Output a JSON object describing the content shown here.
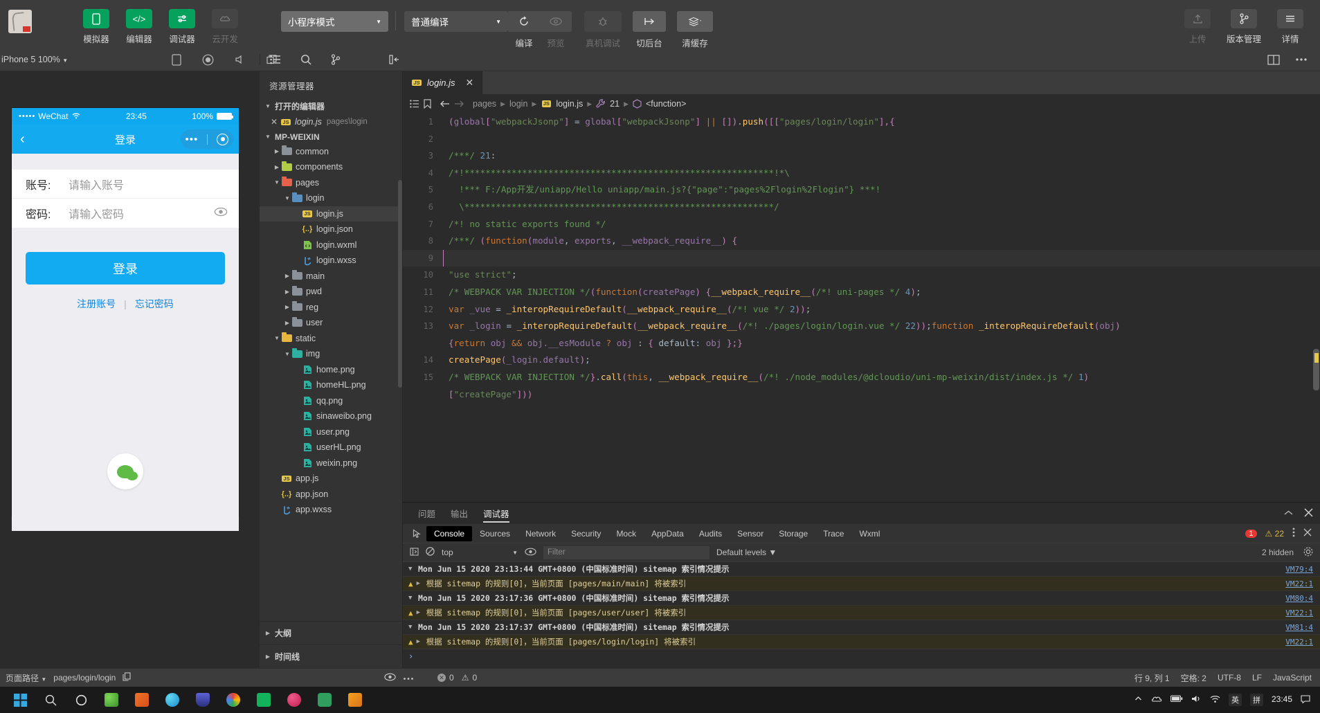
{
  "toolbar": {
    "items": [
      {
        "label": "模拟器",
        "icon": "phone-icon",
        "state": "active"
      },
      {
        "label": "编辑器",
        "icon": "code-icon",
        "state": "active"
      },
      {
        "label": "调试器",
        "icon": "sliders-icon",
        "state": "active"
      },
      {
        "label": "云开发",
        "icon": "cloud-icon",
        "state": "disabled"
      }
    ],
    "mode_select": "小程序模式",
    "compile_select": "普通编译",
    "compile_label": "编译",
    "preview_label": "预览",
    "remote_debug_label": "真机调试",
    "background_label": "切后台",
    "clear_cache_label": "清缓存",
    "upload_label": "上传",
    "version_label": "版本管理",
    "detail_label": "详情"
  },
  "subbar": {
    "device": "iPhone 5 100%"
  },
  "simulator": {
    "status": {
      "carrier": "WeChat",
      "dots": "•••••",
      "time": "23:45",
      "battery": "100%"
    },
    "nav_title": "登录",
    "form": [
      {
        "label": "账号:",
        "placeholder": "请输入账号",
        "value": "",
        "has_eye": false
      },
      {
        "label": "密码:",
        "placeholder": "请输入密码",
        "value": "",
        "has_eye": true
      }
    ],
    "login_button": "登录",
    "link_register": "注册账号",
    "link_divider": "|",
    "link_forgot": "忘记密码"
  },
  "explorer": {
    "title": "资源管理器",
    "open_editors_label": "打开的编辑器",
    "open_editors": [
      {
        "name": "login.js",
        "path": "pages\\login",
        "icon": "js-icon"
      }
    ],
    "project_label": "MP-WEIXIN",
    "tree": [
      {
        "name": "common",
        "type": "folder",
        "depth": 1,
        "open": false,
        "icon": "folder-grey"
      },
      {
        "name": "components",
        "type": "folder",
        "depth": 1,
        "open": false,
        "icon": "folder-green"
      },
      {
        "name": "pages",
        "type": "folder",
        "depth": 1,
        "open": true,
        "icon": "folder-red"
      },
      {
        "name": "login",
        "type": "folder",
        "depth": 2,
        "open": true,
        "icon": "folder-blue"
      },
      {
        "name": "login.js",
        "type": "js",
        "depth": 3,
        "active": true
      },
      {
        "name": "login.json",
        "type": "json",
        "depth": 3
      },
      {
        "name": "login.wxml",
        "type": "wxml",
        "depth": 3
      },
      {
        "name": "login.wxss",
        "type": "wxss",
        "depth": 3
      },
      {
        "name": "main",
        "type": "folder",
        "depth": 2,
        "open": false,
        "icon": "folder-grey"
      },
      {
        "name": "pwd",
        "type": "folder",
        "depth": 2,
        "open": false,
        "icon": "folder-grey"
      },
      {
        "name": "reg",
        "type": "folder",
        "depth": 2,
        "open": false,
        "icon": "folder-grey"
      },
      {
        "name": "user",
        "type": "folder",
        "depth": 2,
        "open": false,
        "icon": "folder-grey"
      },
      {
        "name": "static",
        "type": "folder",
        "depth": 1,
        "open": true,
        "icon": "folder-yellow"
      },
      {
        "name": "img",
        "type": "folder",
        "depth": 2,
        "open": true,
        "icon": "folder-teal"
      },
      {
        "name": "home.png",
        "type": "png",
        "depth": 3
      },
      {
        "name": "homeHL.png",
        "type": "png",
        "depth": 3
      },
      {
        "name": "qq.png",
        "type": "png",
        "depth": 3
      },
      {
        "name": "sinaweibo.png",
        "type": "png",
        "depth": 3
      },
      {
        "name": "user.png",
        "type": "png",
        "depth": 3
      },
      {
        "name": "userHL.png",
        "type": "png",
        "depth": 3
      },
      {
        "name": "weixin.png",
        "type": "png",
        "depth": 3
      },
      {
        "name": "app.js",
        "type": "js",
        "depth": 1
      },
      {
        "name": "app.json",
        "type": "json",
        "depth": 1
      },
      {
        "name": "app.wxss",
        "type": "wxss",
        "depth": 1
      }
    ],
    "outline_label": "大纲",
    "timeline_label": "时间线"
  },
  "editor": {
    "tab": {
      "name": "login.js",
      "icon": "js-icon"
    },
    "breadcrumb": [
      "pages",
      "login",
      "login.js",
      "21",
      "<function>"
    ],
    "lines": [
      {
        "n": "1",
        "html": "<span class=\"pink\">(</span><span class=\"pm\">global</span><span class=\"pink\">[</span><span class=\"str\">\"webpackJsonp\"</span><span class=\"pink\">]</span> <span class=\"wht\">=</span> <span class=\"pm\">global</span><span class=\"pink\">[</span><span class=\"str\">\"webpackJsonp\"</span><span class=\"pink\">]</span> <span class=\"kw\">||</span> <span class=\"pink\">[])</span><span class=\"wht\">.</span><span class=\"fn\">push</span><span class=\"pink\">([[</span><span class=\"str\">\"pages/login/login\"</span><span class=\"pink\">],{</span>"
      },
      {
        "n": "2",
        "html": ""
      },
      {
        "n": "3",
        "html": "<span class=\"cm\">/***/</span> <span class=\"num\">21</span><span class=\"wht\">:</span>"
      },
      {
        "n": "4",
        "html": "<span class=\"cm\">/*!***********************************************************!*\\</span>"
      },
      {
        "n": "5",
        "html": "<span class=\"cm\">  !*** F:/App开发/uniapp/Hello uniapp/main.js?{\"page\":\"pages%2Flogin%2Flogin\"} ***!</span>"
      },
      {
        "n": "6",
        "html": "<span class=\"cm\">  \\***********************************************************/</span>"
      },
      {
        "n": "7",
        "html": "<span class=\"cm\">/*! no static exports found */</span>"
      },
      {
        "n": "8",
        "html": "<span class=\"cm\">/***/</span> <span class=\"pink\">(</span><span class=\"kw\">function</span><span class=\"pink\">(</span><span class=\"pm\">module</span><span class=\"wht\">, </span><span class=\"pm\">exports</span><span class=\"wht\">, </span><span class=\"pm\">__webpack_require__</span><span class=\"pink\">)</span> <span class=\"pink\">{</span>"
      },
      {
        "n": "9",
        "html": "",
        "highlight": true,
        "cursor": true
      },
      {
        "n": "10",
        "html": "<span class=\"str\">\"use strict\"</span><span class=\"wht\">;</span>"
      },
      {
        "n": "11",
        "html": "<span class=\"cm\">/* WEBPACK VAR INJECTION */</span><span class=\"pink\">(</span><span class=\"kw\">function</span><span class=\"pink\">(</span><span class=\"pm\">createPage</span><span class=\"pink\">)</span> <span class=\"pink\">{</span><span class=\"fn\">__webpack_require__</span><span class=\"pink\">(</span><span class=\"cm\">/*! uni-pages */</span> <span class=\"num\">4</span><span class=\"pink\">)</span><span class=\"wht\">;</span>"
      },
      {
        "n": "12",
        "html": "<span class=\"kw\">var</span> <span class=\"pm\">_vue</span> <span class=\"wht\">=</span> <span class=\"fn\">_interopRequireDefault</span><span class=\"pink\">(</span><span class=\"fn\">__webpack_require__</span><span class=\"pink\">(</span><span class=\"cm\">/*! vue */</span> <span class=\"num\">2</span><span class=\"pink\">))</span><span class=\"wht\">;</span>"
      },
      {
        "n": "13",
        "html": "<span class=\"kw\">var</span> <span class=\"pm\">_login</span> <span class=\"wht\">=</span> <span class=\"fn\">_interopRequireDefault</span><span class=\"pink\">(</span><span class=\"fn\">__webpack_require__</span><span class=\"pink\">(</span><span class=\"cm\">/*! ./pages/login/login.vue */</span> <span class=\"num\">22</span><span class=\"pink\">))</span><span class=\"wht\">;</span><span class=\"kw\">function</span> <span class=\"fn\">_interopRequireDefault</span><span class=\"pink\">(</span><span class=\"pm\">obj</span><span class=\"pink\">)</span>"
      },
      {
        "n": "",
        "html": "<span class=\"pink\">{</span><span class=\"kw\">return</span> <span class=\"pm\">obj</span> <span class=\"kw\">&amp;&amp;</span> <span class=\"pm\">obj.__esModule</span> <span class=\"kw\">?</span> <span class=\"pm\">obj</span> <span class=\"wht\">:</span> <span class=\"pink\">{</span> <span class=\"wht\">default: </span><span class=\"pm\">obj</span> <span class=\"pink\">};}</span>"
      },
      {
        "n": "14",
        "html": "<span class=\"fn\">createPage</span><span class=\"pink\">(</span><span class=\"pm\">_login.default</span><span class=\"pink\">)</span><span class=\"wht\">;</span>"
      },
      {
        "n": "15",
        "html": "<span class=\"cm\">/* WEBPACK VAR INJECTION */</span><span class=\"pink\">}</span><span class=\"wht\">.</span><span class=\"fn\">call</span><span class=\"pink\">(</span><span class=\"kw\">this</span><span class=\"wht\">, </span><span class=\"fn\">__webpack_require__</span><span class=\"pink\">(</span><span class=\"cm\">/*! ./node_modules/@dcloudio/uni-mp-weixin/dist/index.js */</span> <span class=\"num\">1</span><span class=\"pink\">)</span>"
      },
      {
        "n": "",
        "html": "<span class=\"pink\">[</span><span class=\"str\">\"createPage\"</span><span class=\"pink\">]))</span>"
      }
    ]
  },
  "debugger": {
    "tabs": [
      {
        "label": "问题",
        "active": false
      },
      {
        "label": "输出",
        "active": false
      },
      {
        "label": "调试器",
        "active": true
      }
    ],
    "devtools_tabs": [
      "Console",
      "Sources",
      "Network",
      "Security",
      "Mock",
      "AppData",
      "Audits",
      "Sensor",
      "Storage",
      "Trace",
      "Wxml"
    ],
    "devtools_selected": "Console",
    "error_count": "1",
    "warning_count": "22",
    "context": "top",
    "filter_placeholder": "Filter",
    "filter_value": "",
    "levels": "Default levels",
    "hidden_label": "2 hidden",
    "logs": [
      {
        "type": "group",
        "text": "Mon Jun 15 2020 23:13:44 GMT+0800 (中国标准时间) sitemap 索引情况提示",
        "source": "VM79:4"
      },
      {
        "type": "warn",
        "text": "根据 sitemap 的规则[0]，当前页面 [pages/main/main] 将被索引",
        "source": "VM22:1"
      },
      {
        "type": "group",
        "text": "Mon Jun 15 2020 23:17:36 GMT+0800 (中国标准时间) sitemap 索引情况提示",
        "source": "VM80:4"
      },
      {
        "type": "warn",
        "text": "根据 sitemap 的规则[0]，当前页面 [pages/user/user] 将被索引",
        "source": "VM22:1"
      },
      {
        "type": "group",
        "text": "Mon Jun 15 2020 23:17:37 GMT+0800 (中国标准时间) sitemap 索引情况提示",
        "source": "VM81:4"
      },
      {
        "type": "warn",
        "text": "根据 sitemap 的规则[0]，当前页面 [pages/login/login] 将被索引",
        "source": "VM22:1"
      }
    ]
  },
  "statusbar": {
    "page_path_label": "页面路径",
    "page_path": "pages/login/login",
    "errors": "0",
    "warnings": "0",
    "cursor": "行 9, 列 1",
    "spaces": "空格: 2",
    "encoding": "UTF-8",
    "eol": "LF",
    "language": "JavaScript"
  },
  "taskbar": {
    "clock_time": "23:45",
    "ime": "英",
    "ime2": "拼"
  }
}
